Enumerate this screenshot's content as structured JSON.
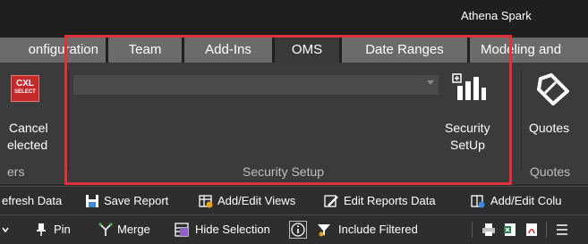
{
  "window": {
    "title": "Athena Spark"
  },
  "tabs": [
    {
      "label": "onfiguration"
    },
    {
      "label": "Team"
    },
    {
      "label": "Add-Ins"
    },
    {
      "label": "OMS",
      "active": true
    },
    {
      "label": "Date Ranges"
    },
    {
      "label": "Modeling and"
    }
  ],
  "ribbon": {
    "cancel_group": {
      "icon_text": "CXL",
      "icon_subtext": "SELECT",
      "label_line1": "Cancel",
      "label_line2": "elected",
      "group_label": "ers"
    },
    "security_group": {
      "combo_value": "",
      "button_line1": "Security",
      "button_line2": "SetUp",
      "group_label": "Security Setup"
    },
    "quotes_group": {
      "button_label": "Quotes",
      "group_label": "Quotes"
    }
  },
  "toolbar1": {
    "refresh": "efresh Data",
    "save_report": "Save Report",
    "add_edit_views": "Add/Edit Views",
    "edit_reports_data": "Edit Reports Data",
    "add_edit_columns": "Add/Edit Colu"
  },
  "toolbar2": {
    "pin": "Pin",
    "merge": "Merge",
    "hide_selection": "Hide Selection",
    "include_filtered": "Include Filtered"
  },
  "colors": {
    "highlight": "#e0313a",
    "cxl_icon": "#c42a2a",
    "active_tab": "#3a3a3a",
    "inactive_tab": "#6b6b6b"
  }
}
